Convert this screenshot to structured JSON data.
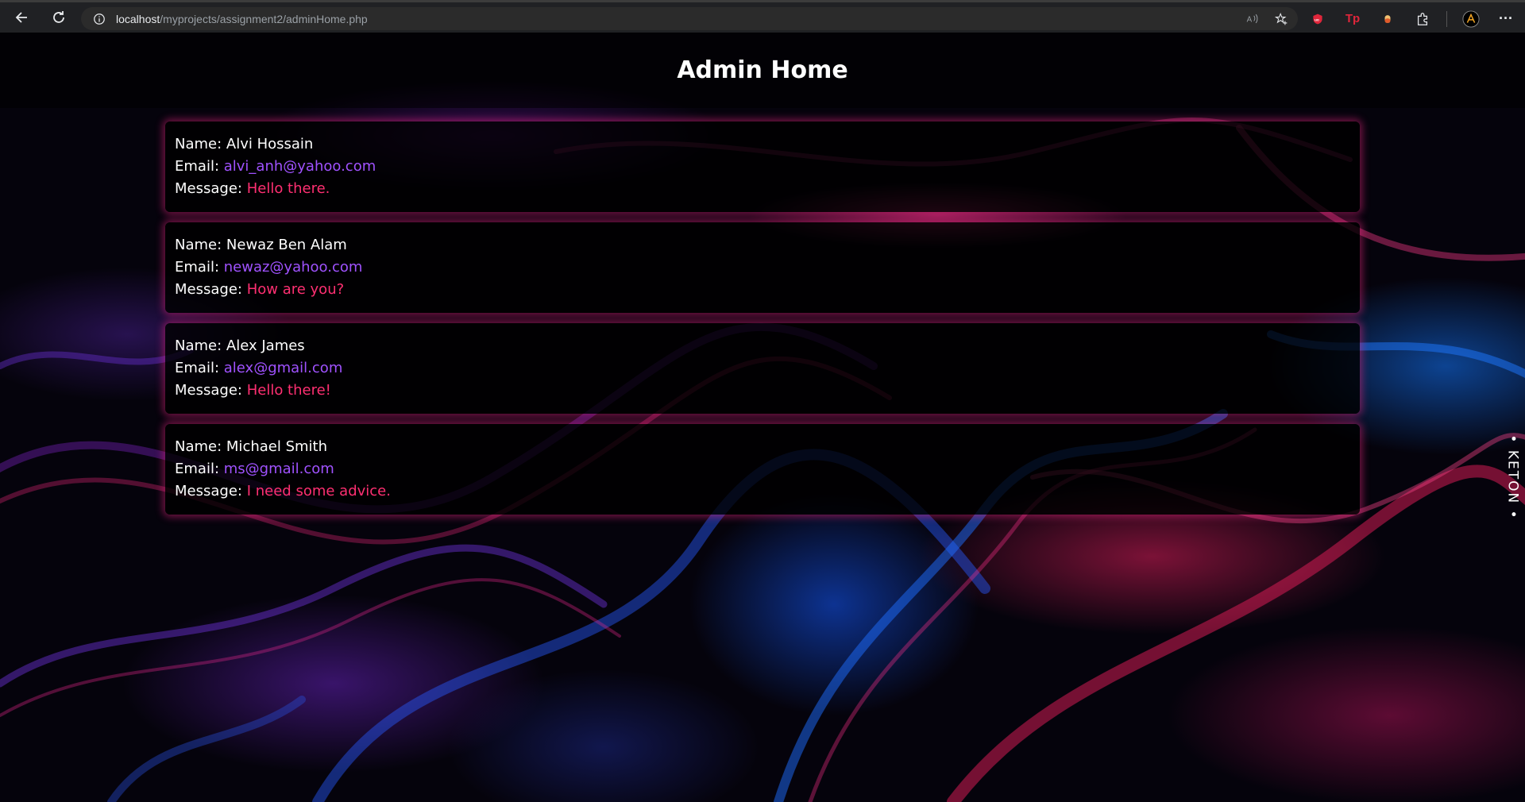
{
  "browser": {
    "url_host": "localhost",
    "url_path": "/myprojects/assignment2/adminHome.php",
    "extensions": [
      {
        "name": "ublock-icon",
        "label": "uo",
        "color": "#e0263b"
      },
      {
        "name": "tp-icon",
        "label": "Tp",
        "color": "#e0263b"
      },
      {
        "name": "ext-orange-icon",
        "label": "",
        "color": "#f5a623"
      }
    ],
    "profile_initial": "A"
  },
  "page": {
    "title": "Admin Home",
    "labels": {
      "name": "Name:",
      "email": "Email:",
      "message": "Message:"
    },
    "messages": [
      {
        "name": "Alvi Hossain",
        "email": "alvi_anh@yahoo.com",
        "message": "Hello there."
      },
      {
        "name": "Newaz Ben Alam",
        "email": "newaz@yahoo.com",
        "message": "How are you?"
      },
      {
        "name": "Alex James",
        "email": "alex@gmail.com",
        "message": "Hello there!"
      },
      {
        "name": "Michael Smith",
        "email": "ms@gmail.com",
        "message": "I need some advice."
      }
    ],
    "side_badge": "• KETON •"
  },
  "colors": {
    "email": "#a052ff",
    "message": "#ff2f72",
    "card_glow": "#ff288c"
  }
}
